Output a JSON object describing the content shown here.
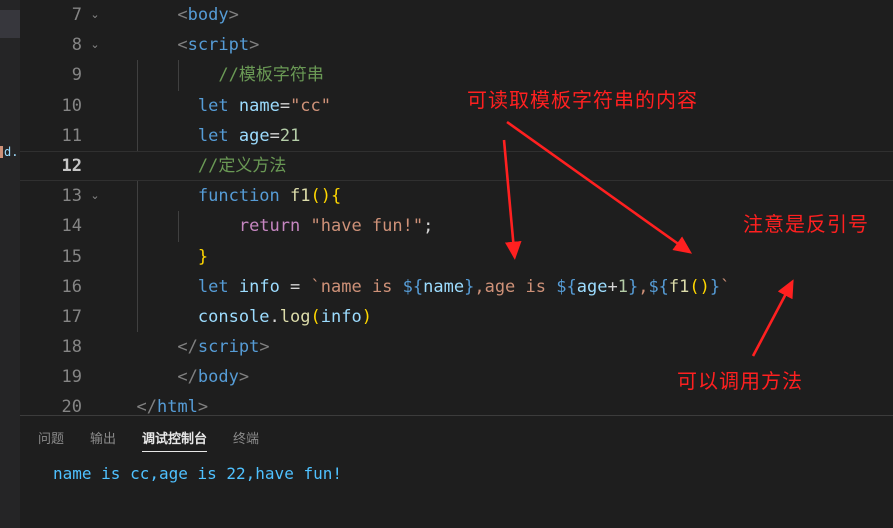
{
  "editor": {
    "lines": [
      {
        "num": "7",
        "fold": "⌄",
        "active": false,
        "indent_guides": 0,
        "tokens": [
          {
            "t": "      ",
            "c": "c-op"
          },
          {
            "t": "<",
            "c": "c-punct"
          },
          {
            "t": "body",
            "c": "c-tag"
          },
          {
            "t": ">",
            "c": "c-punct"
          }
        ]
      },
      {
        "num": "8",
        "fold": "⌄",
        "active": false,
        "indent_guides": 0,
        "tokens": [
          {
            "t": "      ",
            "c": "c-op"
          },
          {
            "t": "<",
            "c": "c-punct"
          },
          {
            "t": "script",
            "c": "c-tag"
          },
          {
            "t": ">",
            "c": "c-punct"
          }
        ]
      },
      {
        "num": "9",
        "fold": "",
        "active": false,
        "indent_guides": 2,
        "tokens": [
          {
            "t": "          //模板字符串",
            "c": "c-comment"
          }
        ]
      },
      {
        "num": "10",
        "fold": "",
        "active": false,
        "indent_guides": 1,
        "tokens": [
          {
            "t": "        ",
            "c": "c-op"
          },
          {
            "t": "let",
            "c": "c-kw"
          },
          {
            "t": " ",
            "c": "c-op"
          },
          {
            "t": "name",
            "c": "c-var"
          },
          {
            "t": "=",
            "c": "c-op"
          },
          {
            "t": "\"cc\"",
            "c": "c-str"
          }
        ]
      },
      {
        "num": "11",
        "fold": "",
        "active": false,
        "indent_guides": 1,
        "tokens": [
          {
            "t": "        ",
            "c": "c-op"
          },
          {
            "t": "let",
            "c": "c-kw"
          },
          {
            "t": " ",
            "c": "c-op"
          },
          {
            "t": "age",
            "c": "c-var"
          },
          {
            "t": "=",
            "c": "c-op"
          },
          {
            "t": "21",
            "c": "c-num"
          }
        ]
      },
      {
        "num": "12",
        "fold": "",
        "active": true,
        "indent_guides": 0,
        "tokens": [
          {
            "t": "        //定义方法",
            "c": "c-comment"
          }
        ]
      },
      {
        "num": "13",
        "fold": "⌄",
        "active": false,
        "indent_guides": 1,
        "tokens": [
          {
            "t": "        ",
            "c": "c-op"
          },
          {
            "t": "function",
            "c": "c-kw"
          },
          {
            "t": " ",
            "c": "c-op"
          },
          {
            "t": "f1",
            "c": "c-fn"
          },
          {
            "t": "()",
            "c": "c-paren"
          },
          {
            "t": "{",
            "c": "c-brace"
          }
        ]
      },
      {
        "num": "14",
        "fold": "",
        "active": false,
        "indent_guides": 2,
        "tokens": [
          {
            "t": "            ",
            "c": "c-op"
          },
          {
            "t": "return",
            "c": "c-ctrl"
          },
          {
            "t": " ",
            "c": "c-op"
          },
          {
            "t": "\"have fun!\"",
            "c": "c-str"
          },
          {
            "t": ";",
            "c": "c-op"
          }
        ]
      },
      {
        "num": "15",
        "fold": "",
        "active": false,
        "indent_guides": 1,
        "tokens": [
          {
            "t": "        ",
            "c": "c-op"
          },
          {
            "t": "}",
            "c": "c-brace"
          }
        ]
      },
      {
        "num": "16",
        "fold": "",
        "active": false,
        "indent_guides": 1,
        "tokens": [
          {
            "t": "        ",
            "c": "c-op"
          },
          {
            "t": "let",
            "c": "c-kw"
          },
          {
            "t": " ",
            "c": "c-op"
          },
          {
            "t": "info",
            "c": "c-var"
          },
          {
            "t": " = ",
            "c": "c-op"
          },
          {
            "t": "`name is ",
            "c": "c-str"
          },
          {
            "t": "${",
            "c": "c-tpl"
          },
          {
            "t": "name",
            "c": "c-var"
          },
          {
            "t": "}",
            "c": "c-tpl"
          },
          {
            "t": ",age is ",
            "c": "c-str"
          },
          {
            "t": "${",
            "c": "c-tpl"
          },
          {
            "t": "age",
            "c": "c-var"
          },
          {
            "t": "+",
            "c": "c-op"
          },
          {
            "t": "1",
            "c": "c-num"
          },
          {
            "t": "}",
            "c": "c-tpl"
          },
          {
            "t": ",",
            "c": "c-str"
          },
          {
            "t": "${",
            "c": "c-tpl"
          },
          {
            "t": "f1",
            "c": "c-fn"
          },
          {
            "t": "()",
            "c": "c-paren"
          },
          {
            "t": "}",
            "c": "c-tpl"
          },
          {
            "t": "`",
            "c": "c-str"
          }
        ]
      },
      {
        "num": "17",
        "fold": "",
        "active": false,
        "indent_guides": 1,
        "tokens": [
          {
            "t": "        ",
            "c": "c-op"
          },
          {
            "t": "console",
            "c": "c-var"
          },
          {
            "t": ".",
            "c": "c-op"
          },
          {
            "t": "log",
            "c": "c-fn"
          },
          {
            "t": "(",
            "c": "c-paren"
          },
          {
            "t": "info",
            "c": "c-var"
          },
          {
            "t": ")",
            "c": "c-paren"
          }
        ]
      },
      {
        "num": "18",
        "fold": "",
        "active": false,
        "indent_guides": 0,
        "tokens": [
          {
            "t": "      ",
            "c": "c-op"
          },
          {
            "t": "</",
            "c": "c-punct"
          },
          {
            "t": "script",
            "c": "c-tag"
          },
          {
            "t": ">",
            "c": "c-punct"
          }
        ]
      },
      {
        "num": "19",
        "fold": "",
        "active": false,
        "indent_guides": 0,
        "tokens": [
          {
            "t": "      ",
            "c": "c-op"
          },
          {
            "t": "</",
            "c": "c-punct"
          },
          {
            "t": "body",
            "c": "c-tag"
          },
          {
            "t": ">",
            "c": "c-punct"
          }
        ]
      },
      {
        "num": "20",
        "fold": "",
        "active": false,
        "indent_guides": 0,
        "tokens": [
          {
            "t": "  ",
            "c": "c-op"
          },
          {
            "t": "</",
            "c": "c-punct"
          },
          {
            "t": "html",
            "c": "c-tag"
          },
          {
            "t": ">",
            "c": "c-punct"
          }
        ]
      }
    ],
    "minimap_fragment": "d..."
  },
  "annotations": {
    "color": "#ff2020",
    "note_read_template": "可读取模板字符串的内容",
    "note_backtick": "注意是反引号",
    "note_call_method": "可以调用方法"
  },
  "panel": {
    "tabs": [
      {
        "label": "问题",
        "active": false
      },
      {
        "label": "输出",
        "active": false
      },
      {
        "label": "调试控制台",
        "active": true
      },
      {
        "label": "终端",
        "active": false
      }
    ],
    "console_output": "name is cc,age is 22,have fun!",
    "console_color": "#4fc1ff"
  }
}
